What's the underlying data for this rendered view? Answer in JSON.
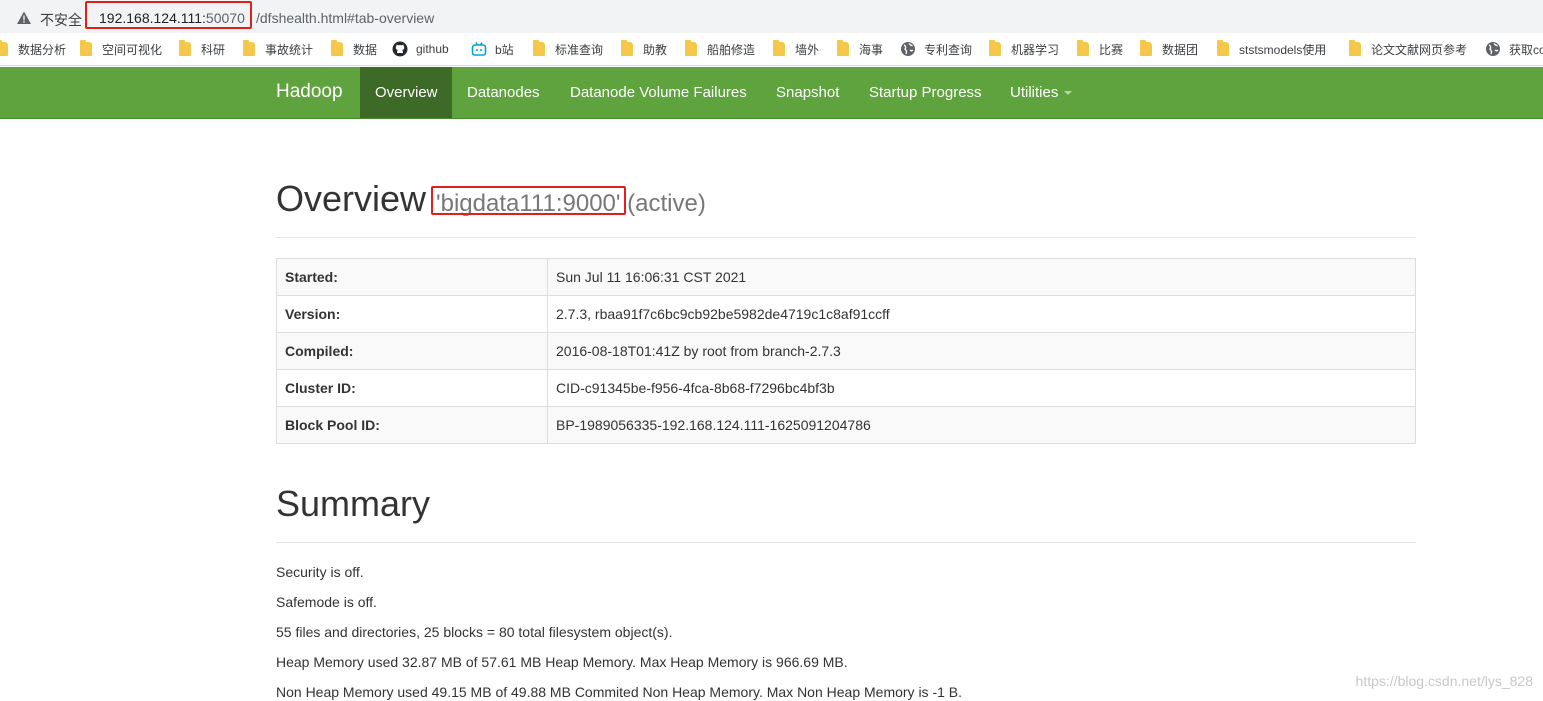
{
  "browser": {
    "insecure_label": "不安全",
    "url_host": "192.168.124.111:",
    "url_port": "50070",
    "url_path": "/dfshealth.html#tab-overview",
    "warning_icon": "warning-triangle-icon"
  },
  "bookmarks": [
    {
      "label": "数据分析",
      "icon": "folder-icon"
    },
    {
      "label": "空间可视化",
      "icon": "folder-icon"
    },
    {
      "label": "科研",
      "icon": "folder-icon"
    },
    {
      "label": "事故统计",
      "icon": "folder-icon"
    },
    {
      "label": "数据",
      "icon": "folder-icon"
    },
    {
      "label": "github",
      "icon": "github-icon"
    },
    {
      "label": "b站",
      "icon": "bilibili-icon"
    },
    {
      "label": "标准查询",
      "icon": "folder-icon"
    },
    {
      "label": "助教",
      "icon": "folder-icon"
    },
    {
      "label": "船舶修造",
      "icon": "folder-icon"
    },
    {
      "label": "墙外",
      "icon": "folder-icon"
    },
    {
      "label": "海事",
      "icon": "folder-icon"
    },
    {
      "label": "专利查询",
      "icon": "globe-icon"
    },
    {
      "label": "机器学习",
      "icon": "folder-icon"
    },
    {
      "label": "比赛",
      "icon": "folder-icon"
    },
    {
      "label": "数据团",
      "icon": "folder-icon"
    },
    {
      "label": "ststsmodels使用",
      "icon": "folder-icon"
    },
    {
      "label": "论文文献网页参考",
      "icon": "folder-icon"
    },
    {
      "label": "获取co",
      "icon": "globe-icon"
    }
  ],
  "navbar": {
    "brand": "Hadoop",
    "items": [
      "Overview",
      "Datanodes",
      "Datanode Volume Failures",
      "Snapshot",
      "Startup Progress",
      "Utilities"
    ],
    "active": "Overview",
    "color": "#5fa33e"
  },
  "overview": {
    "title": "Overview",
    "host": "'bigdata111:9000'",
    "state": " (active)",
    "rows": [
      {
        "key": "Started:",
        "value": "Sun Jul 11 16:06:31 CST 2021"
      },
      {
        "key": "Version:",
        "value": "2.7.3, rbaa91f7c6bc9cb92be5982de4719c1c8af91ccff"
      },
      {
        "key": "Compiled:",
        "value": "2016-08-18T01:41Z by root from branch-2.7.3"
      },
      {
        "key": "Cluster ID:",
        "value": "CID-c91345be-f956-4fca-8b68-f7296bc4bf3b"
      },
      {
        "key": "Block Pool ID:",
        "value": "BP-1989056335-192.168.124.111-1625091204786"
      }
    ]
  },
  "summary": {
    "title": "Summary",
    "lines": [
      "Security is off.",
      "Safemode is off.",
      "55 files and directories, 25 blocks = 80 total filesystem object(s).",
      "Heap Memory used 32.87 MB of 57.61 MB Heap Memory. Max Heap Memory is 966.69 MB.",
      "Non Heap Memory used 49.15 MB of 49.88 MB Commited Non Heap Memory. Max Non Heap Memory is -1 B."
    ]
  },
  "watermark": "https://blog.csdn.net/lys_828"
}
